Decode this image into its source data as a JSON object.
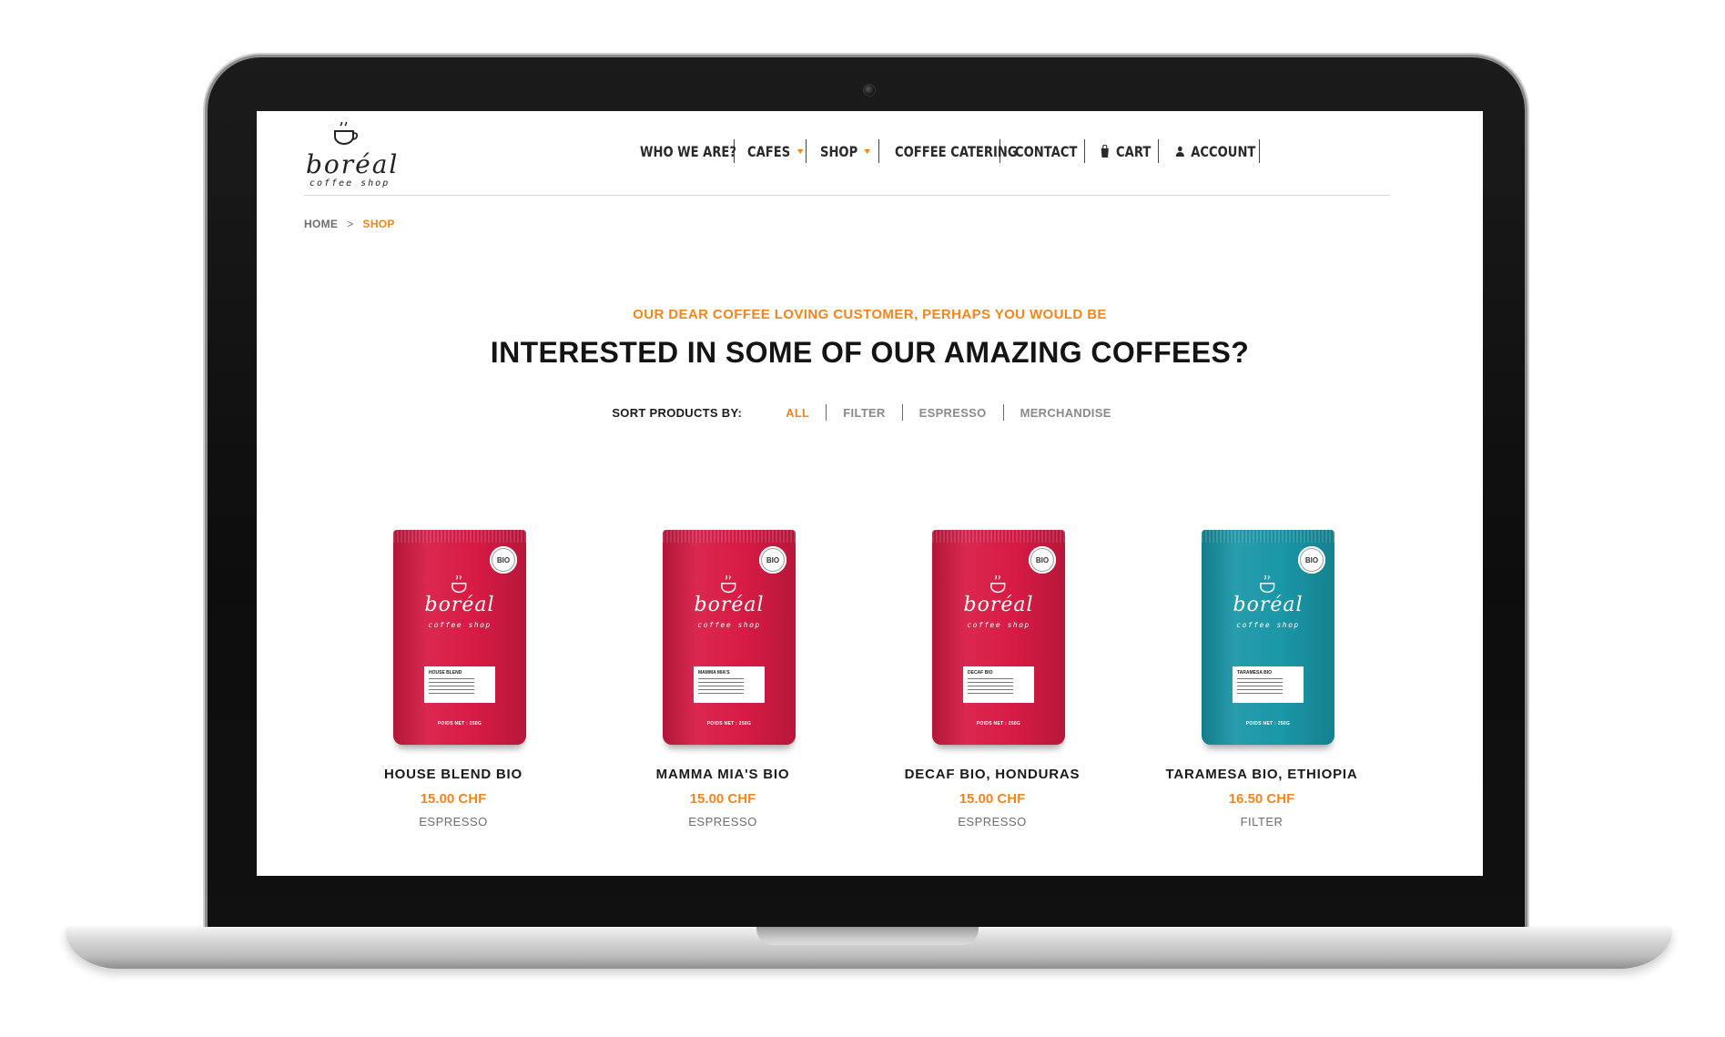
{
  "brand": {
    "name": "boréal",
    "subtitle": "coffee shop"
  },
  "nav": {
    "items": [
      {
        "label": "WHO WE ARE?"
      },
      {
        "label": "CAFES"
      },
      {
        "label": "SHOP"
      },
      {
        "label": "COFFEE CATERING"
      },
      {
        "label": "CONTACT"
      },
      {
        "label": "CART"
      },
      {
        "label": "ACCOUNT"
      }
    ]
  },
  "breadcrumb": {
    "home": "HOME",
    "separator": ">",
    "current": "SHOP"
  },
  "hero": {
    "tagline": "OUR DEAR COFFEE LOVING CUSTOMER, PERHAPS YOU WOULD BE",
    "headline": "INTERESTED IN SOME OF OUR AMAZING COFFEES?"
  },
  "sort": {
    "label": "SORT PRODUCTS BY:",
    "options": [
      "ALL",
      "FILTER",
      "ESPRESSO",
      "MERCHANDISE"
    ],
    "active": "ALL"
  },
  "products": [
    {
      "name": "HOUSE BLEND BIO",
      "price": "15.00 CHF",
      "category": "ESPRESSO",
      "bag_color": "#d81b45",
      "bag_label": "HOUSE BLEND",
      "bio": "BIO",
      "bag_weight": "POIDS NET : 250G"
    },
    {
      "name": "MAMMA MIA'S BIO",
      "price": "15.00 CHF",
      "category": "ESPRESSO",
      "bag_color": "#d81b45",
      "bag_label": "MAMMA MIA'S",
      "bio": "BIO",
      "bag_weight": "POIDS NET : 250G"
    },
    {
      "name": "DECAF BIO, HONDURAS",
      "price": "15.00 CHF",
      "category": "ESPRESSO",
      "bag_color": "#d81b45",
      "bag_label": "DECAF BIO",
      "bio": "BIO",
      "bag_weight": "POIDS NET : 250G"
    },
    {
      "name": "TARAMESA BIO, ETHIOPIA",
      "price": "16.50 CHF",
      "category": "FILTER",
      "bag_color": "#1a97a8",
      "bag_label": "TARAMESA BIO",
      "bio": "BIO",
      "bag_weight": "POIDS NET : 250G"
    }
  ],
  "colors": {
    "accent": "#f0861f",
    "text": "#141414",
    "muted": "#6d6d6d"
  }
}
